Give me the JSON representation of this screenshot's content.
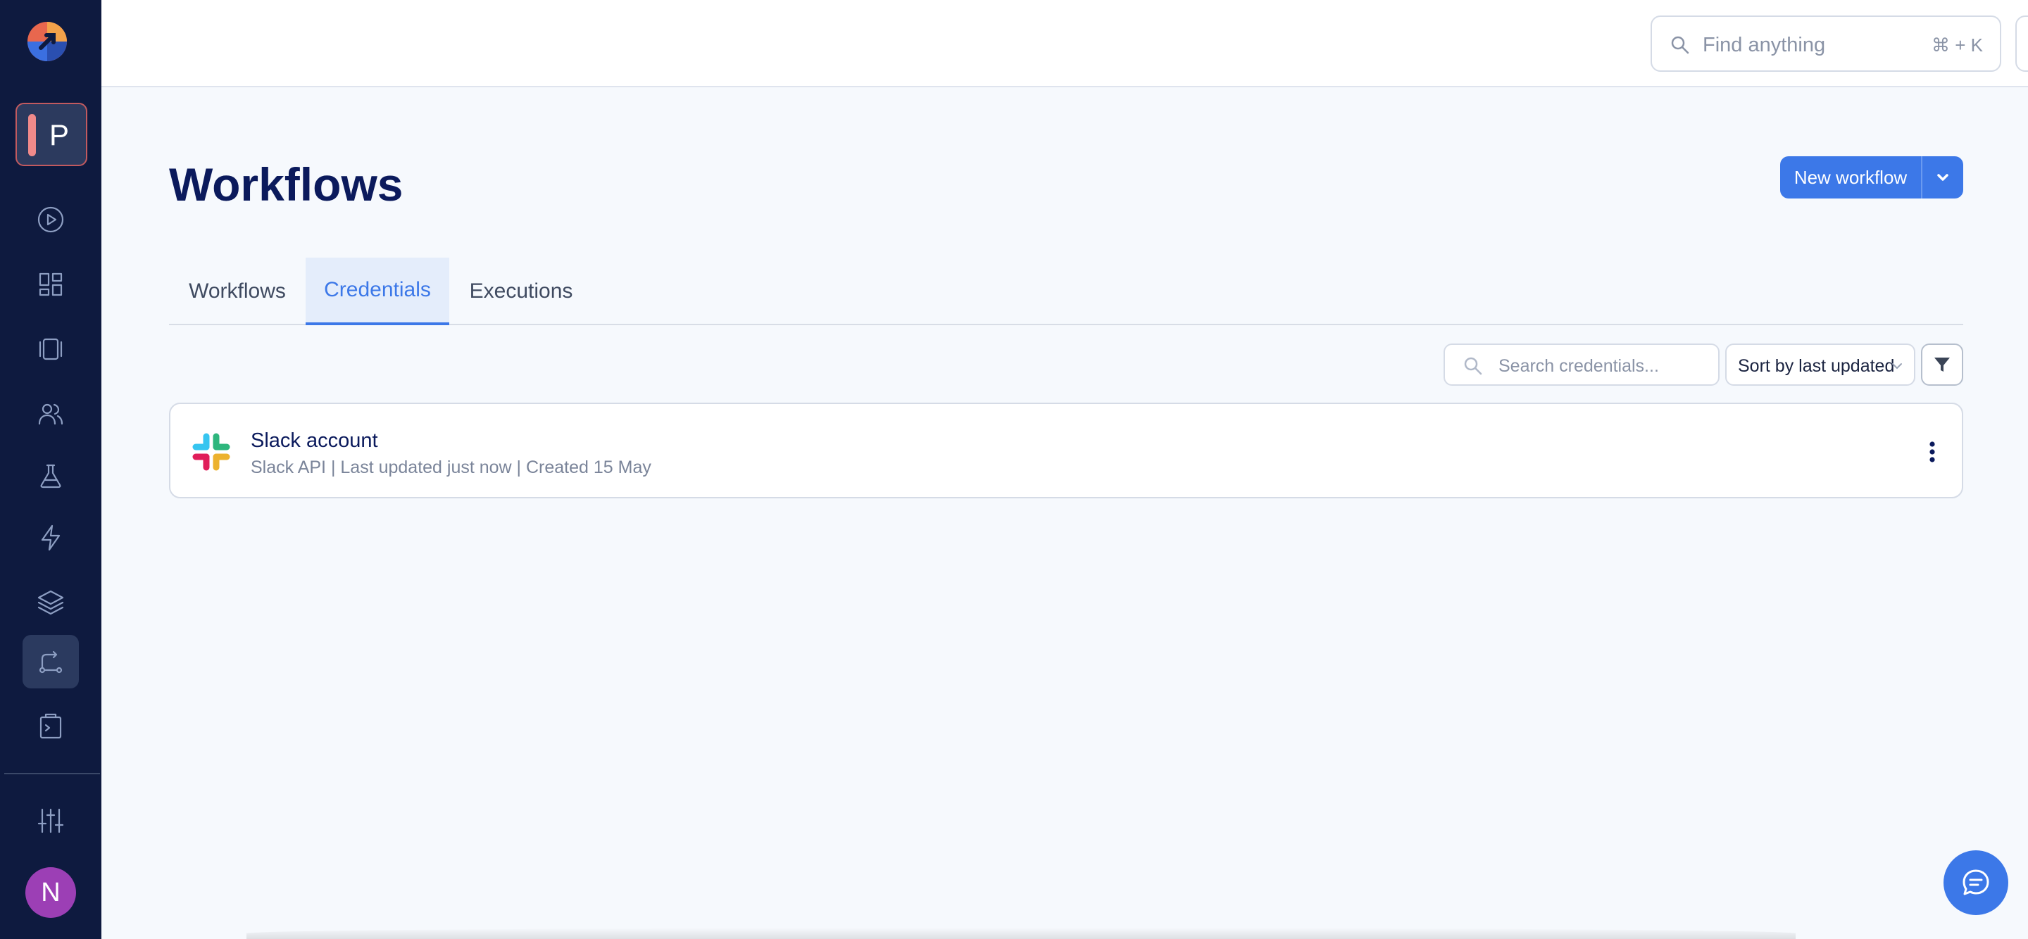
{
  "sidebar": {
    "project_letter": "P",
    "user_initial": "N",
    "items": [
      {
        "name": "executions-icon"
      },
      {
        "name": "dashboard-icon"
      },
      {
        "name": "templates-icon"
      },
      {
        "name": "users-icon"
      },
      {
        "name": "flask-icon"
      },
      {
        "name": "lightning-icon"
      },
      {
        "name": "layers-icon"
      },
      {
        "name": "workflow-icon",
        "active": true
      },
      {
        "name": "clipboard-icon"
      },
      {
        "name": "settings-sliders-icon"
      }
    ]
  },
  "topbar": {
    "search_placeholder": "Find anything",
    "search_shortcut": "⌘ + K",
    "theme_icon": "sun-icon"
  },
  "page": {
    "title": "Workflows",
    "new_button_label": "New workflow"
  },
  "tabs": [
    {
      "label": "Workflows",
      "active": false
    },
    {
      "label": "Credentials",
      "active": true
    },
    {
      "label": "Executions",
      "active": false
    }
  ],
  "toolbar": {
    "search_placeholder": "Search credentials...",
    "sort_label": "Sort by last updated",
    "filter_icon": "filter-icon"
  },
  "credentials": [
    {
      "name": "Slack account",
      "meta": "Slack API | Last updated just now | Created 15 May",
      "icon": "slack-logo-icon"
    }
  ],
  "colors": {
    "sidebar_bg": "#0e1a3f",
    "accent": "#3c78e8",
    "title": "#0b1a5c",
    "avatar": "#9c3fb5"
  }
}
